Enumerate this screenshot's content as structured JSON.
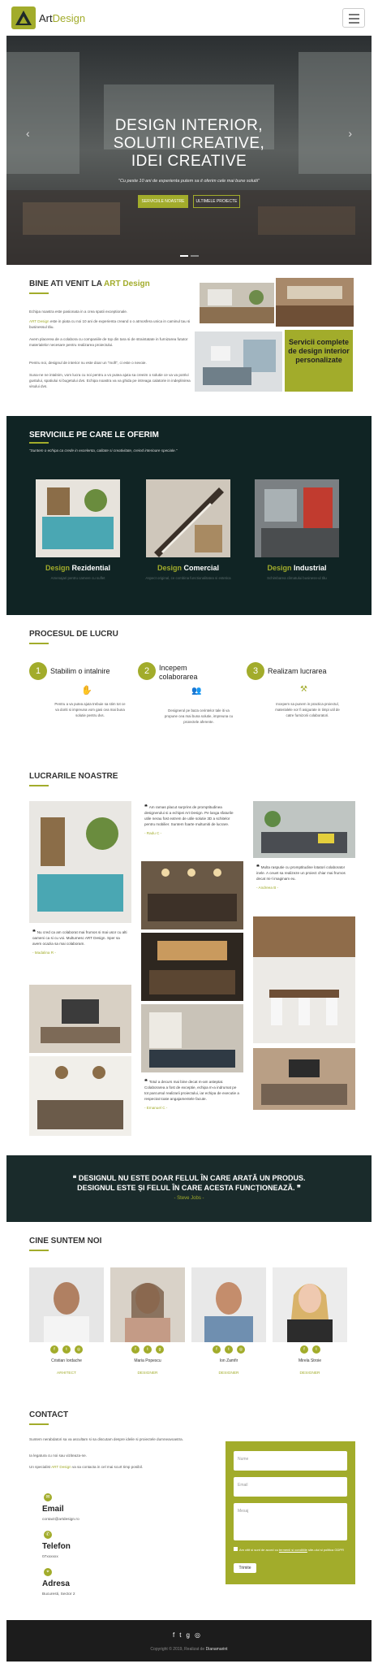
{
  "header": {
    "brand_a": "Art",
    "brand_b": "Design",
    "menu_icon": "hamburger-icon"
  },
  "hero": {
    "title_line1": "DESIGN INTERIOR,",
    "title_line2": "SOLUTII CREATIVE,",
    "title_line3": "IDEI CREATIVE",
    "subtitle": "\"Cu peste 10 ani de experienta putem sa it oferim cele mai bune solutii\"",
    "btn_services": "SERVICIILE NOASTRE",
    "btn_projects": "ULTIMELE PROIECTE"
  },
  "welcome": {
    "title_a": "BINE ATI VENIT LA ",
    "title_b": "ART Design",
    "p1": "Echipa noastra este pasionata in a crea spatii exceptionale.",
    "p2_brand": "ART Design",
    "p2": " este in piata cu noi 10 ani de experienta creand o o atmosfera unica in caminul tau si businessul tău.",
    "p3": "Avem placerea de a colabora cu companiile de top din tara si de straintatate in furnizarea fututor materialelor necesare pentru realizarea proiectului.",
    "p4": "Pentru noi, designul de interior nu este doar un \"moft\", ci este o nevoie.",
    "p5": "Suna-ne ne intalnim, vom lucra cu noi pentru a vo putea ajuta sa creeim o solutie ce va va potrivi gustului, spatiului si bugetului dvs. Echipa noastra va va ghida pe intreaga calatorie in indeplinirea visului dvs.",
    "card": "Servicii complete de design interior personalizate"
  },
  "services": {
    "title": "SERVICIILE PE CARE LE OFERIM",
    "subtitle": "\"Suntem o echipa ca crede in excelenta, calitate si creativitate, creind interioare speciale.\"",
    "items": [
      {
        "a": "Design ",
        "b": "Rezidential",
        "desc": "Amenajari pentru camere cu suflet"
      },
      {
        "a": "Design ",
        "b": "Comercial",
        "desc": "Aspect original, ce combina functionalitatea si estetica"
      },
      {
        "a": "Design ",
        "b": "Industrial",
        "desc": "Schimbarea climatului business-ul tău"
      }
    ]
  },
  "process": {
    "title": "PROCESUL DE LUCRU",
    "steps": [
      {
        "n": "1",
        "t": "Stabilim o intalnire",
        "d": "Pentru a va putea ajuta trebuie sa stim tot ce va doriti si impreuna vom gasi cea mai buna solutie pentru dvs."
      },
      {
        "n": "2",
        "t": "Incepem colaborarea",
        "d": "Designerul pe baza cerintelor tale iti va propune cea mai buna solutie, impreuna cu proiectele aferente."
      },
      {
        "n": "3",
        "t": "Realizam lucrarea",
        "d": "Incepem sa punem in practica proiectul, materialele vor fi asigurate in timpi util de catre furnizorii colaboratori."
      }
    ]
  },
  "works": {
    "title": "LUCRARILE NOASTRE",
    "quotes": [
      {
        "q": "Am ramas placut surprins de promptitudinea designerului si a echipei Art Design. Pe langa sfaturile utile nerau fost extrem de utile solutie 3D a schitelor pentru mobilier. Suntem foarte multumiti de lucrare.",
        "a": "- Radu C -"
      },
      {
        "q": "Nu cred ca am colaborat mai frumos si mai usor cu alti oameni ca si cu voi. Multumesc ART Design. Sper sa avem ocazia sa mai colaboram.",
        "a": "- Madalina R -"
      },
      {
        "q": "Multa rasputie cu promptitudine lotatori colaborator inele. A ceuet sa realizeze un proiect chiar mai frumos decat mi-l imaginam eu.",
        "a": "- Andreea B -"
      },
      {
        "q": "Totul a decurs mai bine decat m-am asteptat. Colaborarea a fost de exceptie, echipa m-a indrumat pe tot parcursul realizarii proiectului, iar echipa de executie a respectat toate angajamentele facute.",
        "a": "- Emanuel C -"
      }
    ]
  },
  "banner": {
    "quote_l1": "DESIGNUL NU ESTE DOAR FELUL ÎN CARE ARATĂ UN PRODUS.",
    "quote_l2": "DESIGNUL ESTE ȘI FELUL ÎN CARE ACESTA FUNCȚIONEAZĂ.",
    "author": "- Steve Jobs -"
  },
  "team": {
    "title": "CINE SUNTEM NOI",
    "members": [
      {
        "name": "Cristian Iordache",
        "role": "ARHITECT"
      },
      {
        "name": "Maria Popescu",
        "role": "DESIGNER"
      },
      {
        "name": "Ion Zamfir",
        "role": "DESIGNER"
      },
      {
        "name": "Mirela Stroie",
        "role": "DESIGNER"
      }
    ]
  },
  "contact": {
    "title": "CONTACT",
    "p1": "Suntem nerabdatori sa va ascultam si sa discutam despre ideile si proiectele dumneavoastra.",
    "p2": "Ia legatura cu noi sau viziteaza-ne.",
    "p3_a": "Un specialist ",
    "p3_b": "ART Design",
    "p3_c": " va sa contacta in cel mai scurt timp posibil.",
    "email_h": "Email",
    "email_v": "contact@artdesign.ro",
    "phone_h": "Telefon",
    "phone_v": "07xxxxxx",
    "addr_h": "Adresa",
    "addr_v": "Bucuresti, Sector 2",
    "form": {
      "name": "Nume",
      "email": "Email",
      "msg": "Mesaj",
      "consent_a": "Am citit si sunt de acord cu ",
      "consent_link": "termenii si conditiile",
      "consent_b": " site-ului si politica GDPR",
      "send": "Trimite"
    }
  },
  "footer": {
    "copy": "Copyright © 2019, Realizat de ",
    "maker": "Dianamarint"
  },
  "colors": {
    "accent": "#a2ac2b",
    "dark": "#102424"
  }
}
